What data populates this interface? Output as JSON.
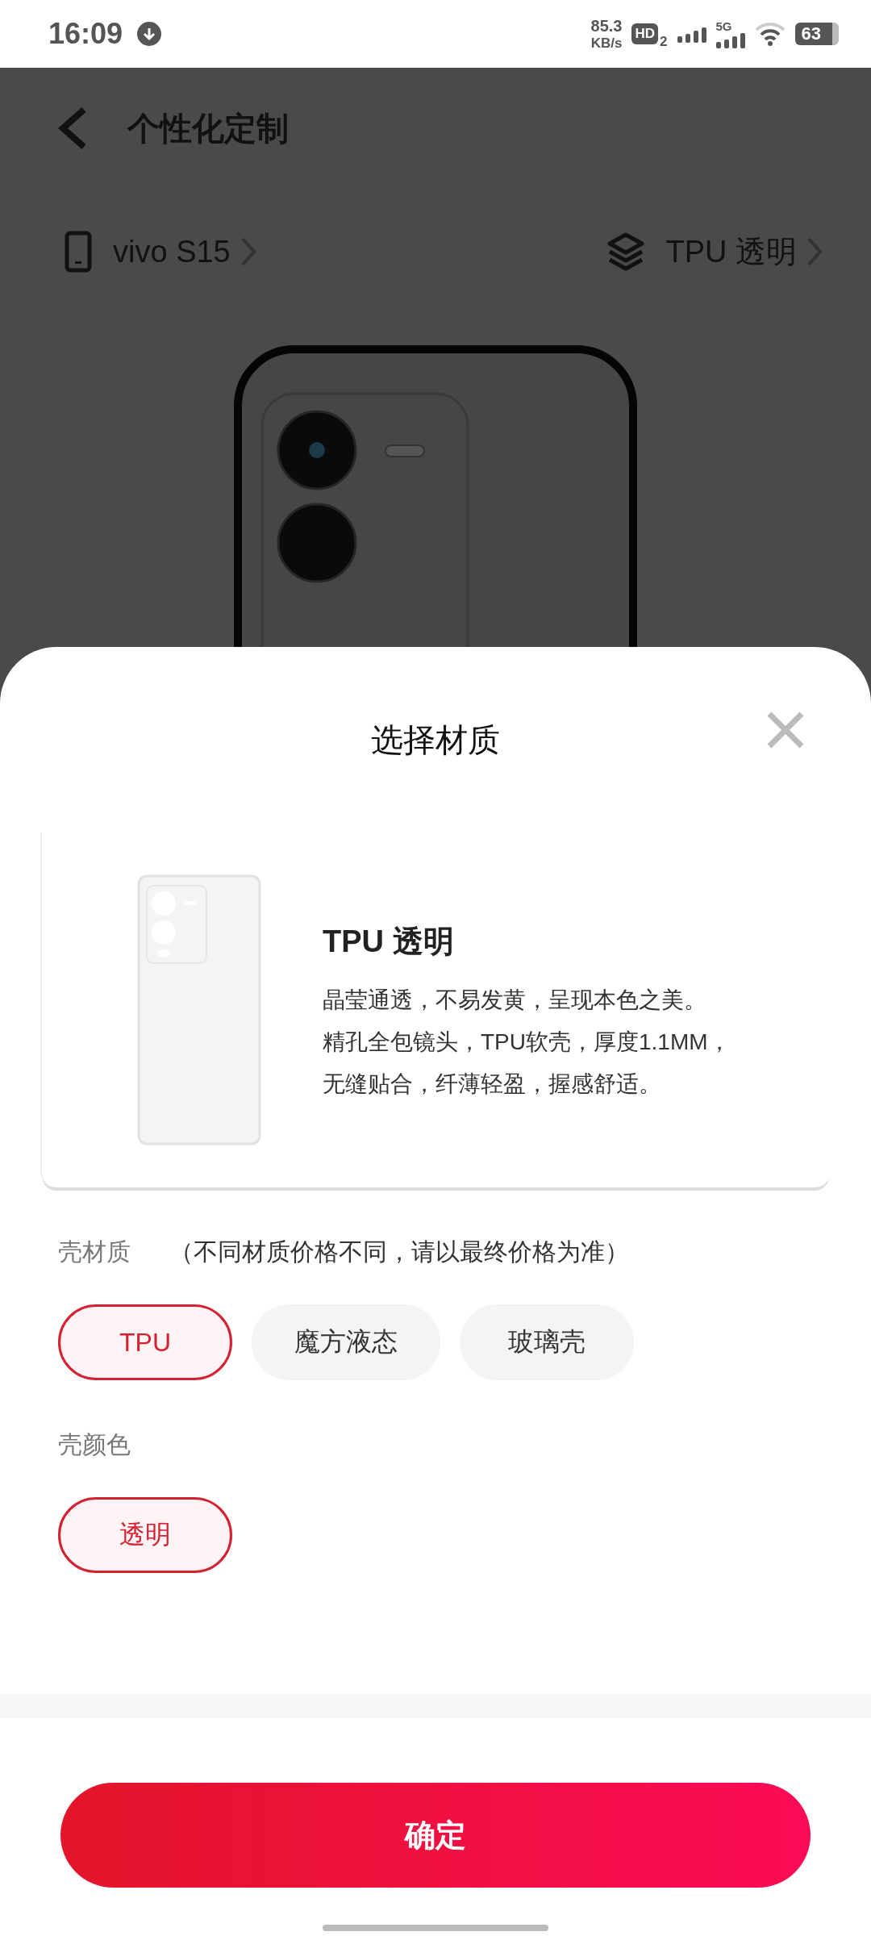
{
  "status_bar": {
    "time": "16:09",
    "speed_value": "85.3",
    "speed_unit": "KB/s",
    "hd_label": "HD",
    "hd_index": "2",
    "network": "5G",
    "battery": "63"
  },
  "header": {
    "title": "个性化定制"
  },
  "selectors": [
    {
      "kind": "model",
      "label": "vivo S15"
    },
    {
      "kind": "material",
      "label": "TPU 透明"
    }
  ],
  "sheet": {
    "title": "选择材质",
    "product": {
      "name": "TPU 透明",
      "description": [
        "晶莹通透，不易发黄，呈现本色之美。",
        "精孔全包镜头，TPU软壳，厚度1.1MM，",
        "无缝贴合，纤薄轻盈，握感舒适。"
      ]
    },
    "groups": [
      {
        "label": "壳材质",
        "note": "（不同材质价格不同，请以最终价格为准）",
        "options": [
          {
            "label": "TPU",
            "selected": true
          },
          {
            "label": "魔方液态",
            "selected": false
          },
          {
            "label": "玻璃壳",
            "selected": false
          }
        ]
      },
      {
        "label": "壳颜色",
        "options": [
          {
            "label": "透明",
            "selected": true
          }
        ]
      }
    ],
    "confirm": "确定"
  }
}
